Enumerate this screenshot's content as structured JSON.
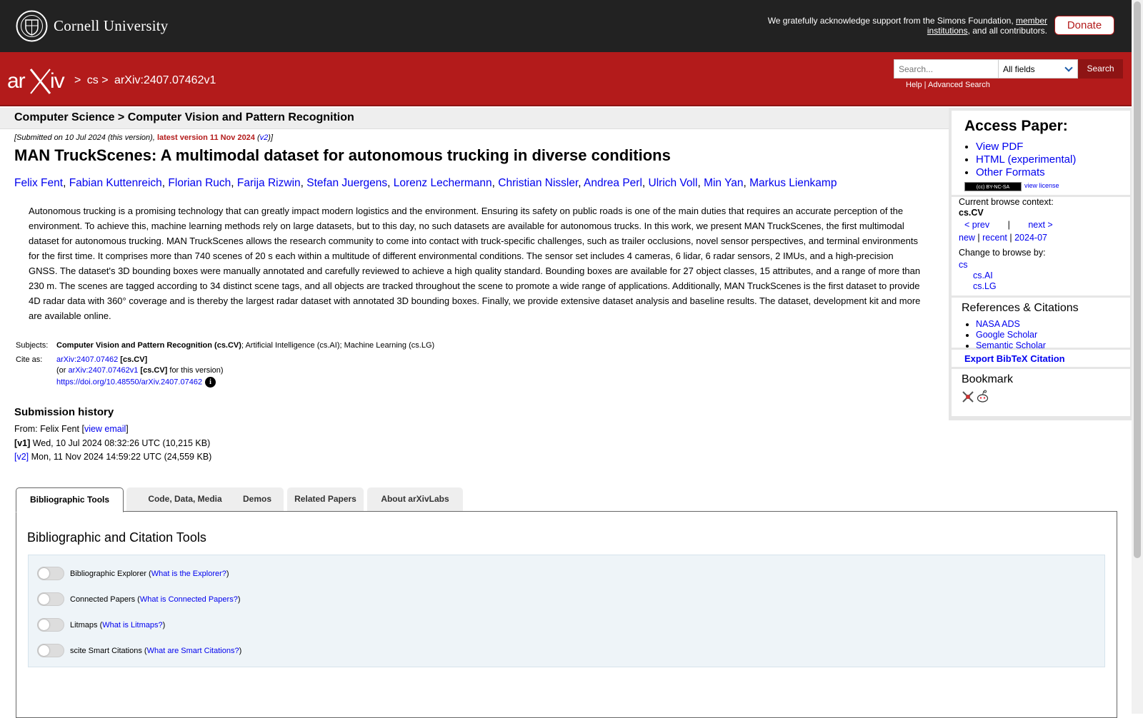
{
  "cornell": {
    "name": "Cornell University",
    "ack_prefix": "We gratefully acknowledge support from the Simons Foundation, ",
    "ack_link": "member institutions",
    "ack_suffix": ", and all contributors.",
    "donate_label": "Donate"
  },
  "header": {
    "breadcrumb": [
      ">",
      "cs",
      ">",
      "arXiv:2407.07462v1"
    ],
    "search_placeholder": "Search...",
    "field_select": "All fields",
    "search_label": "Search",
    "help_label": "Help",
    "sep": " | ",
    "advanced_label": "Advanced Search"
  },
  "paper": {
    "category_path": "Computer Science > Computer Vision and Pattern Recognition",
    "submitted_prefix": "[Submitted on 10 Jul 2024 (this version), ",
    "latest_version": "latest version 11 Nov 2024",
    "latest_link": "v2",
    "submitted_suffix": ")]",
    "title": "MAN TruckScenes: A multimodal dataset for autonomous trucking in diverse conditions",
    "authors": [
      "Felix Fent",
      "Fabian Kuttenreich",
      "Florian Ruch",
      "Farija Rizwin",
      "Stefan Juergens",
      "Lorenz Lechermann",
      "Christian Nissler",
      "Andrea Perl",
      "Ulrich Voll",
      "Min Yan",
      "Markus Lienkamp"
    ],
    "abstract": "Autonomous trucking is a promising technology that can greatly impact modern logistics and the environment. Ensuring its safety on public roads is one of the main duties that requires an accurate perception of the environment. To achieve this, machine learning methods rely on large datasets, but to this day, no such datasets are available for autonomous trucks. In this work, we present MAN TruckScenes, the first multimodal dataset for autonomous trucking. MAN TruckScenes allows the research community to come into contact with truck-specific challenges, such as trailer occlusions, novel sensor perspectives, and terminal environments for the first time. It comprises more than 740 scenes of 20 s each within a multitude of different environmental conditions. The sensor set includes 4 cameras, 6 lidar, 6 radar sensors, 2 IMUs, and a high-precision GNSS. The dataset's 3D bounding boxes were manually annotated and carefully reviewed to achieve a high quality standard. Bounding boxes are available for 27 object classes, 15 attributes, and a range of more than 230 m. The scenes are tagged according to 34 distinct scene tags, and all objects are tracked throughout the scene to promote a wide range of applications. Additionally, MAN TruckScenes is the first dataset to provide 4D radar data with 360° coverage and is thereby the largest radar dataset with annotated 3D bounding boxes. Finally, we provide extensive dataset analysis and baseline results. The dataset, development kit and more are available online."
  },
  "meta": {
    "subjects_label": "Subjects:",
    "subjects_primary": "Computer Vision and Pattern Recognition (cs.CV)",
    "subjects_rest": "; Artificial Intelligence (cs.AI); Machine Learning (cs.LG)",
    "cite_label": "Cite as:",
    "cite_id": "arXiv:2407.07462",
    "cite_cat": "[cs.CV]",
    "cite_or": "(or ",
    "cite_version_id": "arXiv:2407.07462v1",
    "cite_version_cat": "[cs.CV]",
    "cite_version_suffix": " for this version)",
    "doi": "https://doi.org/10.48550/arXiv.2407.07462",
    "info_icon": "i"
  },
  "history": {
    "heading": "Submission history",
    "from_prefix": "From: Felix Fent [",
    "view_email": "view email",
    "from_suffix": "]",
    "v1_label": "[v1]",
    "v1_text": " Wed, 10 Jul 2024 08:32:26 UTC (10,215 KB)",
    "v2_label": "[v2]",
    "v2_text": " Mon, 11 Nov 2024 14:59:22 UTC (24,559 KB)"
  },
  "tabs": [
    "Bibliographic Tools",
    "Code, Data, Media",
    "Demos",
    "Related Papers",
    "About arXivLabs"
  ],
  "panel": {
    "title": "Bibliographic and Citation Tools",
    "tools": [
      {
        "label": "Bibliographic Explorer (",
        "link": "What is the Explorer?",
        "suffix": ")"
      },
      {
        "label": "Connected Papers (",
        "link": "What is Connected Papers?",
        "suffix": ")"
      },
      {
        "label": "Litmaps (",
        "link": "What is Litmaps?",
        "suffix": ")"
      },
      {
        "label": "scite Smart Citations (",
        "link": "What are Smart Citations?",
        "suffix": ")"
      }
    ]
  },
  "sidebar": {
    "access_title": "Access Paper:",
    "access_links": [
      "View PDF",
      "HTML (experimental)",
      "Other Formats"
    ],
    "cc_badge": "(cc) BY-NC-SA",
    "view_license": "view license",
    "context_label": "Current browse context:",
    "context_value": "cs.CV",
    "prev": "< prev",
    "pipe": "|",
    "next": "next >",
    "new": "new",
    "recent": "recent",
    "date": "2024-07",
    "change_label": "Change to browse by:",
    "browse_cs": "cs",
    "browse_ai": "cs.AI",
    "browse_lg": "cs.LG",
    "refs_heading": "References & Citations",
    "refs": [
      "NASA ADS",
      "Google Scholar",
      "Semantic Scholar"
    ],
    "export_bibtex": "Export BibTeX Citation",
    "bookmark_heading": "Bookmark",
    "bookmark_icons": [
      "science-wise-icon",
      "reddit-icon"
    ]
  },
  "colors": {
    "arxiv_red": "#b31b1b",
    "cornell_dark": "#222222",
    "link_blue": "#0000ee"
  }
}
